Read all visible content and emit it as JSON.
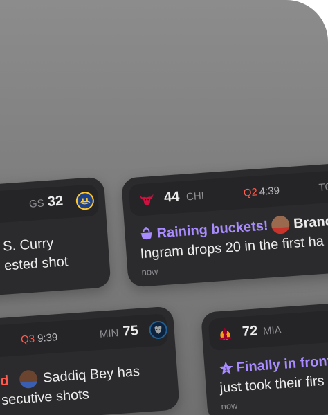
{
  "cards": {
    "curry": {
      "team_abbr": "GS",
      "score": "32",
      "line1": "S. Curry",
      "line2": "ested shot"
    },
    "ingram": {
      "team_abbr": "CHI",
      "score": "44",
      "quarter": "Q2",
      "clock": "4:39",
      "opp_abbr": "TO",
      "headline": "Raining buckets!",
      "headline_name": "Brand",
      "body": "Ingram drops 20 in the first ha",
      "time": "now"
    },
    "bey": {
      "quarter": "Q3",
      "clock": "9:39",
      "team_abbr": "MIN",
      "score": "75",
      "line_prefix": "d",
      "line1": "Saddiq Bey has",
      "line2": "secutive shots"
    },
    "heat": {
      "score": "72",
      "team_abbr": "MIA",
      "headline": "Finally in front",
      "body": "just took their firs",
      "time": "now"
    }
  },
  "colors": {
    "card_bg": "#2b2b2d",
    "strip_bg": "#252527",
    "accent_purple": "#a78bff",
    "accent_red": "#ff5a4e",
    "warriors_blue": "#1d428a",
    "warriors_gold": "#ffc72c",
    "bulls_red": "#ce1141",
    "wolves_navy": "#0c2340",
    "heat_red": "#98002e"
  },
  "icons": {
    "gs_logo": "warriors-logo-icon",
    "chi_logo": "bulls-logo-icon",
    "min_logo": "timberwolves-logo-icon",
    "mia_logo": "heat-logo-icon",
    "raining": "basket-icon",
    "star": "star-icon"
  }
}
